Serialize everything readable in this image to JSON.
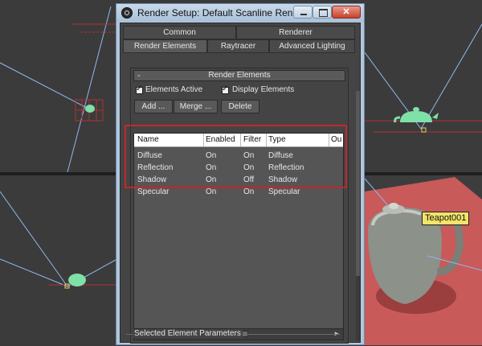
{
  "window": {
    "title": "Render Setup: Default Scanline Renderer",
    "close_glyph": "✕"
  },
  "tabs": {
    "row1": [
      "Common",
      "Renderer"
    ],
    "row2": [
      "Render Elements",
      "Raytracer",
      "Advanced Lighting"
    ],
    "active": "Render Elements"
  },
  "rollout": {
    "title": "Render Elements",
    "collapse_glyph": "-",
    "elements_active_label": "Elements Active",
    "display_elements_label": "Display Elements",
    "elements_active_checked": true,
    "display_elements_checked": true,
    "buttons": {
      "add": "Add ...",
      "merge": "Merge ...",
      "delete": "Delete"
    }
  },
  "list": {
    "columns": [
      "Name",
      "Enabled",
      "Filter",
      "Type",
      "Ou"
    ],
    "rows": [
      {
        "name": "Diffuse",
        "enabled": "On",
        "filter": "On",
        "type": "Diffuse"
      },
      {
        "name": "Reflection",
        "enabled": "On",
        "filter": "On",
        "type": "Reflection"
      },
      {
        "name": "Shadow",
        "enabled": "On",
        "filter": "Off",
        "type": "Shadow"
      },
      {
        "name": "Specular",
        "enabled": "On",
        "filter": "On",
        "type": "Specular"
      }
    ],
    "scroll_left": "◄",
    "scroll_right": "►",
    "scroll_grip": "|||"
  },
  "selected_params_label": "Selected Element Parameters",
  "viewport": {
    "object_label": "Teapot001"
  },
  "colors": {
    "highlight": "#c0282c",
    "teapot_green": "#7fe0a8",
    "viewport_bg": "#3b3b3b",
    "floor_red": "#c85a5a"
  }
}
